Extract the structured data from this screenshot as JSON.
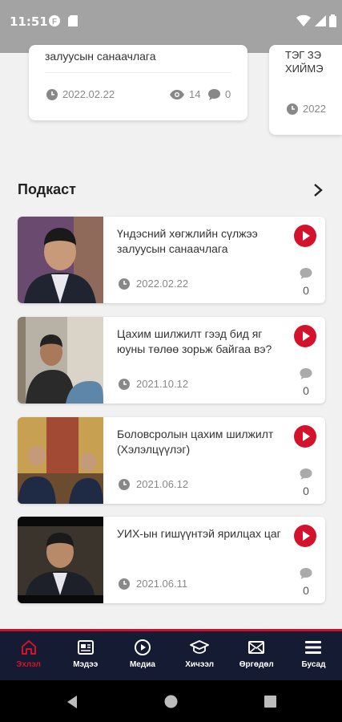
{
  "status_bar": {
    "time": "11:51"
  },
  "top_cards": [
    {
      "title": "залуусын санаачлага",
      "date": "2022.02.22",
      "views": "14",
      "comments": "0"
    },
    {
      "title": "ТЭГ ЗЭ\nХИЙМЭ",
      "date": "2022"
    }
  ],
  "podcast": {
    "section_title": "Подкаст",
    "items": [
      {
        "title": "Үндэсний хөгжлийн сүлжээ залуусын санаачлага",
        "date": "2022.02.22",
        "comments": "0"
      },
      {
        "title": "Цахим шилжилт гээд бид яг юуны төлөө зорьж байгаа вэ?",
        "date": "2021.10.12",
        "comments": "0"
      },
      {
        "title": "Боловсролын цахим шилжилт (Хэлэлцүүлэг)",
        "date": "2021.06.12",
        "comments": "0"
      },
      {
        "title": "УИХ-ын гишүүнтэй ярилцах цаг",
        "date": "2021.06.11",
        "comments": "0"
      }
    ]
  },
  "bottom_nav": [
    {
      "label": "Эхлэл",
      "icon": "home-icon",
      "active": true
    },
    {
      "label": "Мэдээ",
      "icon": "news-icon"
    },
    {
      "label": "Медиа",
      "icon": "play-circle-icon"
    },
    {
      "label": "Хичээл",
      "icon": "graduation-cap-icon"
    },
    {
      "label": "Өргөдөл",
      "icon": "mail-icon"
    },
    {
      "label": "Бусад",
      "icon": "menu-icon"
    }
  ],
  "colors": {
    "accent": "#d4122b",
    "nav_bg": "#151b33",
    "status_bar": "#a3a3a3"
  }
}
